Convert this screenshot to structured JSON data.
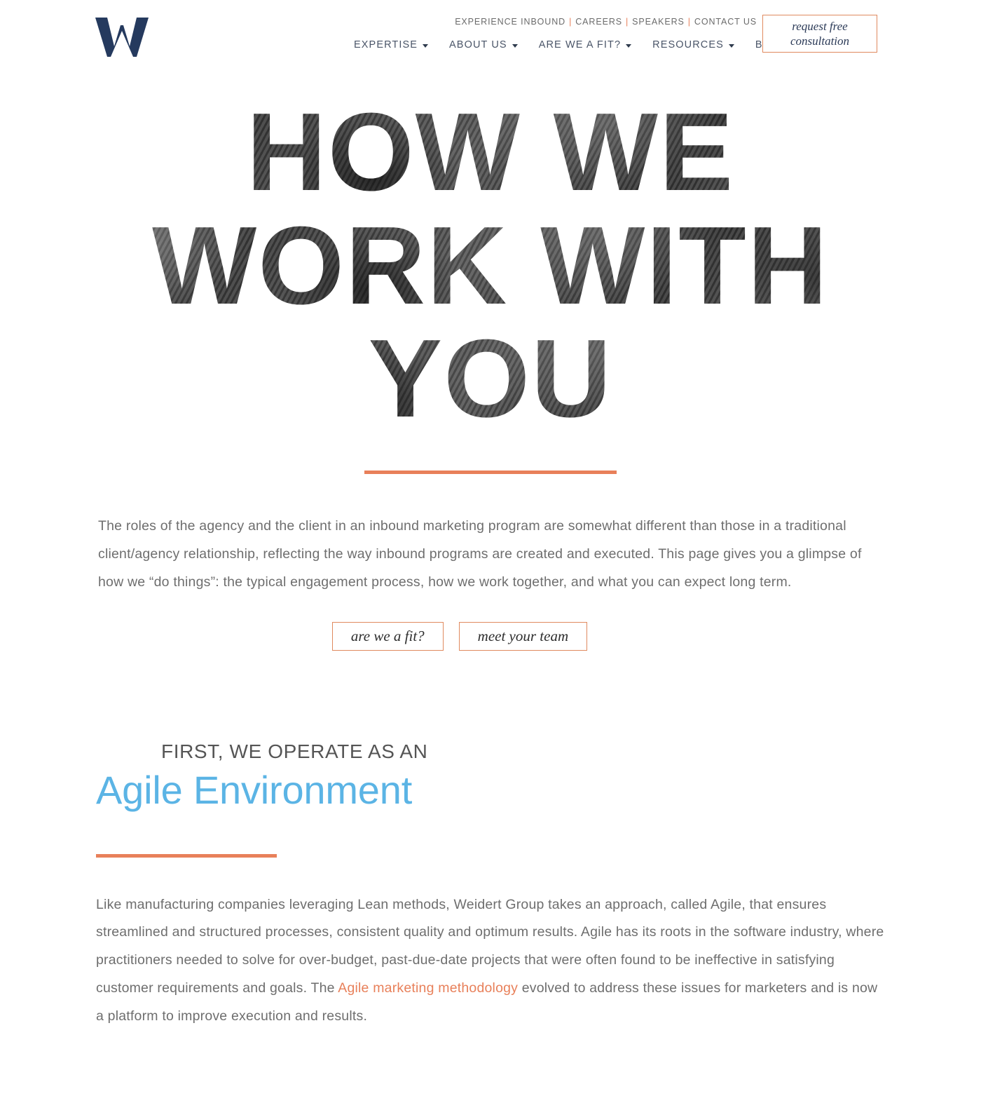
{
  "header": {
    "logo_name": "W",
    "utility_nav": [
      {
        "label": "EXPERIENCE INBOUND"
      },
      {
        "label": "CAREERS"
      },
      {
        "label": "SPEAKERS"
      },
      {
        "label": "CONTACT US"
      }
    ],
    "separator": "|",
    "main_nav": [
      {
        "label": "EXPERTISE",
        "has_dropdown": true
      },
      {
        "label": "ABOUT US",
        "has_dropdown": true
      },
      {
        "label": "ARE WE A FIT?",
        "has_dropdown": true
      },
      {
        "label": "RESOURCES",
        "has_dropdown": true
      },
      {
        "label": "BLOG",
        "has_dropdown": false
      }
    ],
    "cta": {
      "line1": "request free",
      "line2": "consultation"
    }
  },
  "hero": {
    "line1": "HOW WE",
    "line2": "WORK WITH",
    "line3": "YOU",
    "paragraph": "The roles of the agency and the client in an inbound marketing program are somewhat different than those in a traditional client/agency relationship, reflecting the way inbound programs are created and executed. This page gives you a glimpse of how we “do things”: the typical engagement process, how we work together, and what you can expect long term.",
    "buttons": [
      {
        "label": "are we a fit?"
      },
      {
        "label": "meet your team"
      }
    ]
  },
  "agile": {
    "eyebrow": "FIRST, WE OPERATE AS AN",
    "title": "Agile Environment",
    "body_part1": "Like manufacturing companies leveraging Lean methods, Weidert Group takes an approach, called Agile, that ensures streamlined and structured processes, consistent quality and optimum results. Agile has its roots in the software industry, where practitioners needed to solve for over-budget, past-due-date projects that were often found to be ineffective in satisfying customer requirements and goals. The ",
    "link_text": "Agile marketing methodology",
    "body_part2": " evolved to address these issues for marketers and is now a platform to improve execution and results."
  },
  "colors": {
    "navy": "#253a5e",
    "orange": "#e8805a",
    "blue": "#5bb4e5",
    "body_gray": "#6e6e6e"
  }
}
